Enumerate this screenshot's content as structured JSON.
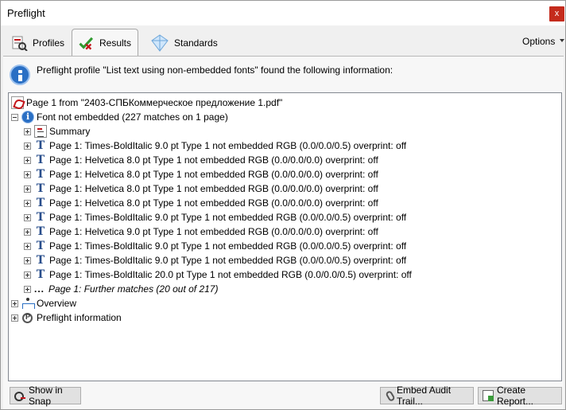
{
  "window": {
    "title": "Preflight",
    "close_glyph": "x"
  },
  "tabs": [
    {
      "label": "Profiles",
      "icon": "profiles-icon"
    },
    {
      "label": "Results",
      "icon": "results-check-icon",
      "active": true
    },
    {
      "label": "Standards",
      "icon": "standards-diamond-icon"
    }
  ],
  "options_label": "Options",
  "info": {
    "message": "Preflight profile \"List text using non-embedded fonts\" found the following information:"
  },
  "tree": {
    "page_root": "Page 1 from \"2403-СПБКоммерческое предложение 1.pdf\"",
    "group": "Font not embedded (227 matches on 1 page)",
    "summary": "Summary",
    "matches": [
      "Page 1: Times-BoldItalic 9.0 pt Type 1 not embedded RGB (0.0/0.0/0.5)  overprint: off",
      "Page 1: Helvetica 8.0 pt Type 1 not embedded RGB (0.0/0.0/0.0)  overprint: off",
      "Page 1: Helvetica 8.0 pt Type 1 not embedded RGB (0.0/0.0/0.0)  overprint: off",
      "Page 1: Helvetica 8.0 pt Type 1 not embedded RGB (0.0/0.0/0.0)  overprint: off",
      "Page 1: Helvetica 8.0 pt Type 1 not embedded RGB (0.0/0.0/0.0)  overprint: off",
      "Page 1: Times-BoldItalic 9.0 pt Type 1 not embedded RGB (0.0/0.0/0.5)  overprint: off",
      "Page 1: Helvetica 9.0 pt Type 1 not embedded RGB (0.0/0.0/0.0)  overprint: off",
      "Page 1: Times-BoldItalic 9.0 pt Type 1 not embedded RGB (0.0/0.0/0.5)  overprint: off",
      "Page 1: Times-BoldItalic 9.0 pt Type 1 not embedded RGB (0.0/0.0/0.5)  overprint: off",
      "Page 1: Times-BoldItalic 20.0 pt Type 1 not embedded RGB (0.0/0.0/0.5)  overprint: off"
    ],
    "further_dots": "...",
    "further": "Page 1: Further matches (20 out of 217)",
    "overview": "Overview",
    "preflight_info": "Preflight information"
  },
  "buttons": {
    "show_in_snap": "Show in Snap",
    "embed_audit_trail": "Embed Audit Trail...",
    "create_report": "Create Report..."
  },
  "colors": {
    "accent_blue": "#2a6fc4",
    "pdf_red": "#c4161c",
    "close_red": "#c42b1c"
  }
}
